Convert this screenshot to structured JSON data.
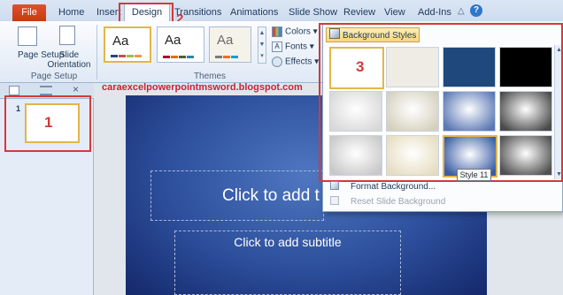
{
  "ribbon_tabs": {
    "file": "File",
    "home": "Home",
    "insert": "Insert",
    "design": "Design",
    "transitions": "Transitions",
    "animations": "Animations",
    "slide_show": "Slide Show",
    "review": "Review",
    "view": "View",
    "add_ins": "Add-Ins",
    "help": "?"
  },
  "page_setup_group": {
    "page_setup_label": "Page Setup",
    "slide_orientation_label": "Slide Orientation",
    "group_label": "Page Setup"
  },
  "themes_group": {
    "theme_sample_text": "Aa",
    "group_label": "Themes",
    "colors_label": "Colors",
    "fonts_label": "Fonts",
    "effects_label": "Effects"
  },
  "background_styles": {
    "button_label": "Background Styles",
    "format_background": "Format Background...",
    "reset_background": "Reset Slide Background",
    "tooltip": "Style 11",
    "styles": [
      {
        "color": "#ffffff"
      },
      {
        "color": "#eeece4"
      },
      {
        "color": "#1f497d"
      },
      {
        "color": "#000000"
      },
      {
        "color": "#d8d8d8"
      },
      {
        "color": "#d5d0bd"
      },
      {
        "color": "#5a78b4"
      },
      {
        "color": "#4a4a4a"
      },
      {
        "color": "#c8c8c8"
      },
      {
        "color": "#e6ddc0"
      },
      {
        "color": "#3a5da6"
      },
      {
        "color": "#505050"
      }
    ]
  },
  "slides_pane": {
    "slide_number": "1"
  },
  "slide": {
    "title_placeholder": "Click to add t",
    "subtitle_placeholder": "Click to add subtitle"
  },
  "annotations": {
    "callout_1": "1",
    "callout_2": "2",
    "callout_3": "3",
    "watermark": "caraexcelpowerpointmsword.blogspot.com"
  },
  "colors": {
    "callout_red": "#d23a3a",
    "file_tab": "#d44a20",
    "selected_gold": "#e3b64a"
  }
}
